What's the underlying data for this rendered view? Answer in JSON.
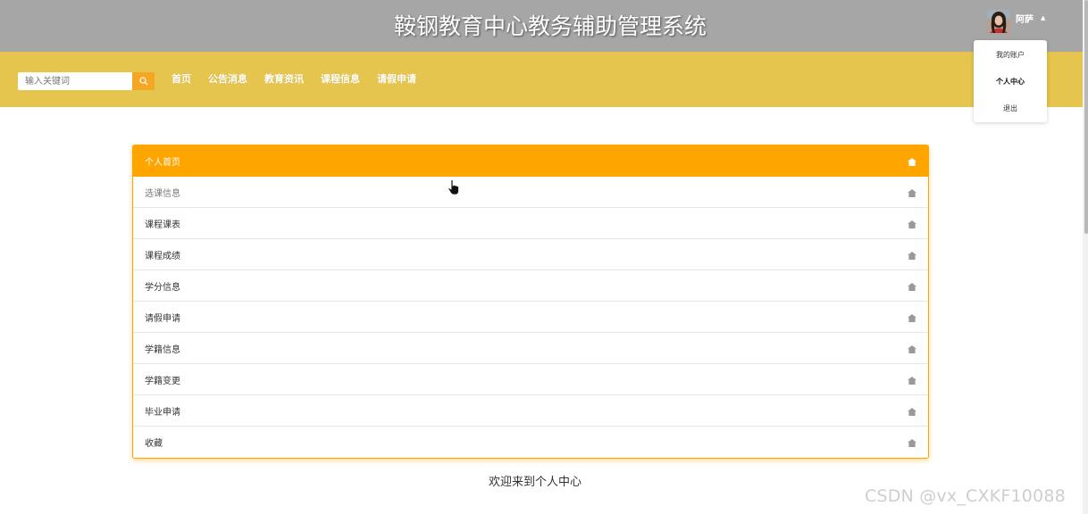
{
  "header": {
    "title": "鞍钢教育中心教务辅助管理系统",
    "user_name": "阿萨",
    "caret_icon": "caret-up-icon",
    "background_color": "#a6a6a6"
  },
  "navbar": {
    "search_placeholder": "输入关键词",
    "search_icon": "search-icon",
    "links": [
      "首页",
      "公告消息",
      "教育资讯",
      "课程信息",
      "请假申请"
    ],
    "background_color": "#e6c54f"
  },
  "dropdown": {
    "items": [
      "我的账户",
      "个人中心",
      "退出"
    ],
    "active_item": "个人中心"
  },
  "menu": {
    "accent_color": "#ffa500",
    "item_icon": "home-icon",
    "items": [
      "个人首页",
      "选课信息",
      "课程课表",
      "课程成绩",
      "学分信息",
      "请假申请",
      "学籍信息",
      "学籍变更",
      "毕业申请",
      "收藏"
    ],
    "active_item": "个人首页"
  },
  "main": {
    "welcome_text": "欢迎来到个人中心"
  },
  "watermark": "CSDN @vx_CXKF10088"
}
